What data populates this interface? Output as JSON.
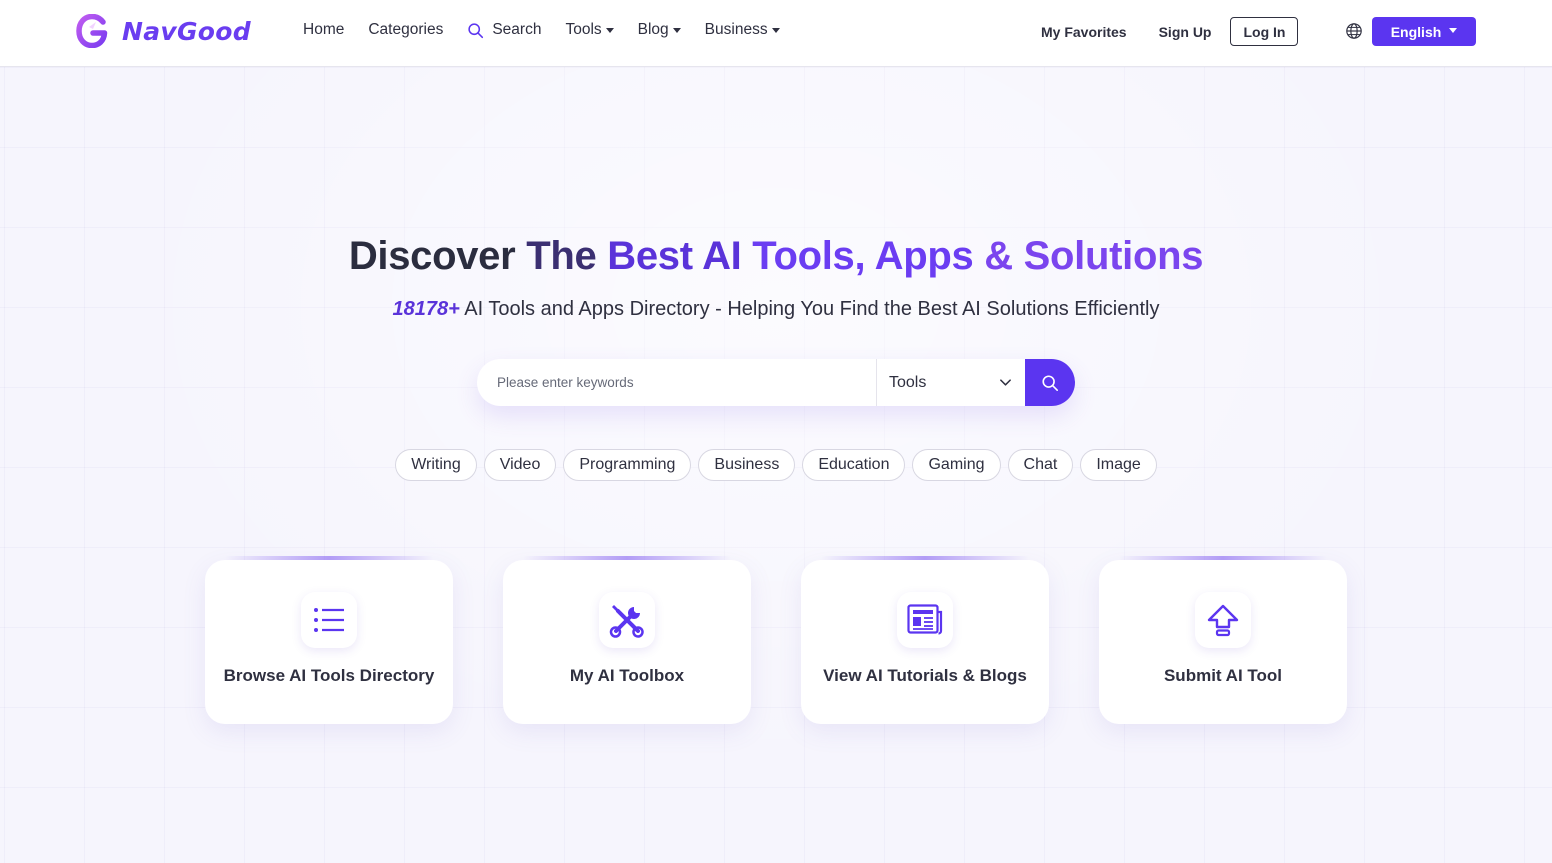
{
  "brand": {
    "name": "NavGood"
  },
  "nav": {
    "home": "Home",
    "categories": "Categories",
    "search": "Search",
    "tools": "Tools",
    "blog": "Blog",
    "business": "Business"
  },
  "header_right": {
    "favorites": "My Favorites",
    "signup": "Sign Up",
    "login": "Log In",
    "language": "English"
  },
  "hero": {
    "title_part1": "Discover ",
    "title_part2": "The ",
    "title_part3": "Best AI ",
    "title_part4": "Tools, Apps ",
    "title_part5": "& Solutions",
    "count": "18178+",
    "subtitle": " AI Tools and Apps Directory - Helping You Find the Best AI Solutions Efficiently"
  },
  "search": {
    "placeholder": "Please enter keywords",
    "value": "",
    "selected_type": "Tools"
  },
  "tags": [
    "Writing",
    "Video",
    "Programming",
    "Business",
    "Education",
    "Gaming",
    "Chat",
    "Image"
  ],
  "cards": [
    {
      "label": "Browse AI Tools Directory",
      "icon": "list-icon"
    },
    {
      "label": "My AI Toolbox",
      "icon": "tools-icon"
    },
    {
      "label": "View AI Tutorials & Blogs",
      "icon": "newspaper-icon"
    },
    {
      "label": "Submit AI Tool",
      "icon": "upload-icon"
    }
  ],
  "colors": {
    "accent": "#5b35f0",
    "brand": "#6a3df0",
    "background": "#f6f5fd"
  }
}
